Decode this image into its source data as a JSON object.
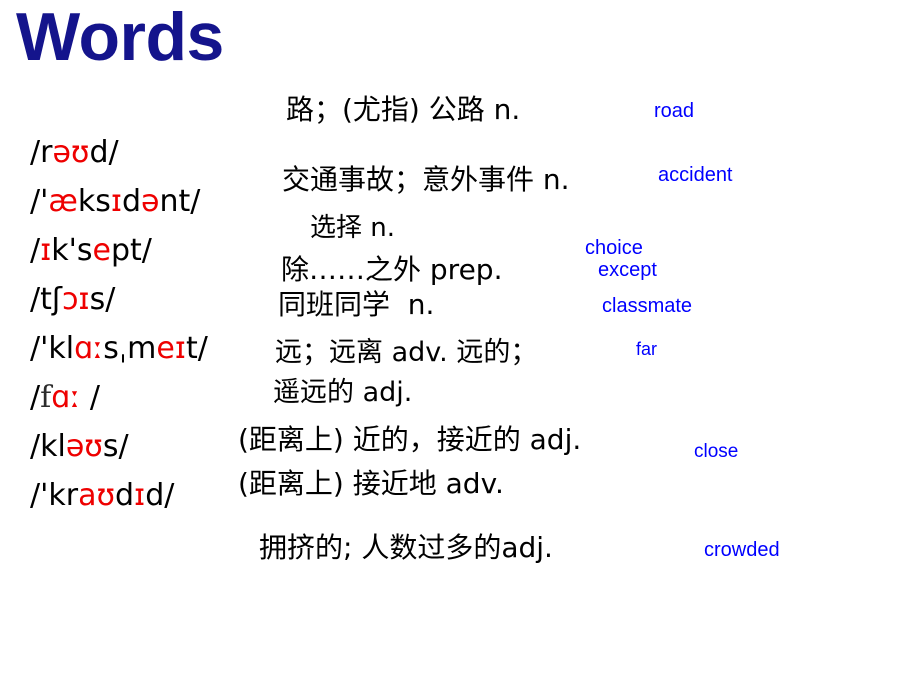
{
  "slide": {
    "title": "Words",
    "title_color": "#14148c",
    "background_color": "#ffffff",
    "accent_word_color": "#0000ff",
    "vowel_highlight_color": "#ee0000"
  },
  "phonetics": [
    {
      "id": "road",
      "text": "/rəʊd/"
    },
    {
      "id": "accident",
      "text": "/'æksɪdənt/"
    },
    {
      "id": "except",
      "text": "/ɪk'sept/"
    },
    {
      "id": "choice",
      "text": "/tʃɔɪs/"
    },
    {
      "id": "classmate",
      "text": "/'klɑːsˌmeɪt/"
    },
    {
      "id": "far",
      "text": "/fɑː /"
    },
    {
      "id": "close",
      "text": "/kləʊs/"
    },
    {
      "id": "crowded",
      "text": "/'kraʊdɪd/"
    }
  ],
  "meanings": {
    "road": "路；(尤指) 公路 n.",
    "accident": "交通事故；意外事件 n.",
    "choice": "选择 n.",
    "except": "除……之外 prep.",
    "classmate": "同班同学  n.",
    "far_line1": "远；远离 adv. 远的；",
    "far_line2": "遥远的 adj.",
    "close_line1": "(距离上) 近的，接近的 adj.",
    "close_line2": "(距离上) 接近地 adv.",
    "crowded": "拥挤的; 人数过多的adj."
  },
  "words": [
    {
      "id": "road",
      "label": "road"
    },
    {
      "id": "accident",
      "label": "accident"
    },
    {
      "id": "choice",
      "label": "choice"
    },
    {
      "id": "except",
      "label": "except"
    },
    {
      "id": "classmate",
      "label": "classmate"
    },
    {
      "id": "far",
      "label": "far"
    },
    {
      "id": "close",
      "label": "close"
    },
    {
      "id": "crowded",
      "label": "crowded"
    }
  ]
}
